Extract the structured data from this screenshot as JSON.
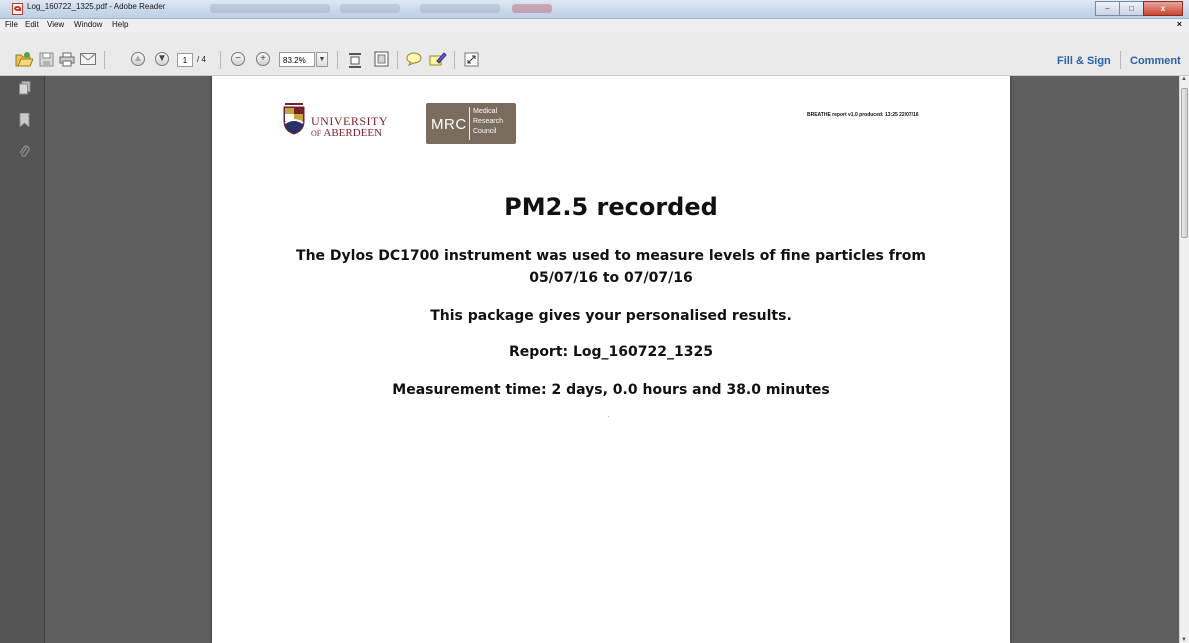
{
  "window": {
    "title": "Log_160722_1325.pdf - Adobe Reader",
    "buttons": [
      "–",
      "□",
      "x"
    ]
  },
  "menu": {
    "items": [
      "File",
      "Edit",
      "View",
      "Window",
      "Help"
    ],
    "close": "×"
  },
  "toolbar": {
    "page_current": "1",
    "page_total": "/ 4",
    "zoom": "83.2%",
    "fill_sign": "Fill & Sign",
    "comment": "Comment"
  },
  "document": {
    "university": {
      "line1": "UNIVERSITY",
      "line2_of": "OF",
      "line2_name": "ABERDEEN"
    },
    "mrc": {
      "abbr": "MRC",
      "line1": "Medical",
      "line2": "Research",
      "line3": "Council"
    },
    "produced": "BREATHE report v1.0 produced: 13:25 22/07/16",
    "title": "PM2.5 recorded",
    "intro_line1": "The Dylos DC1700 instrument was used to measure levels of fine particles from",
    "intro_line2": "05/07/16 to 07/07/16",
    "package": "This package gives your personalised results.",
    "report": "Report: Log_160722_1325",
    "measurement": "Measurement time: 2 days, 0.0 hours and 38.0 minutes"
  },
  "colors": {
    "accent": "#2a62a8",
    "university": "#7d1f2b",
    "mrc": "#7a6c5f"
  }
}
